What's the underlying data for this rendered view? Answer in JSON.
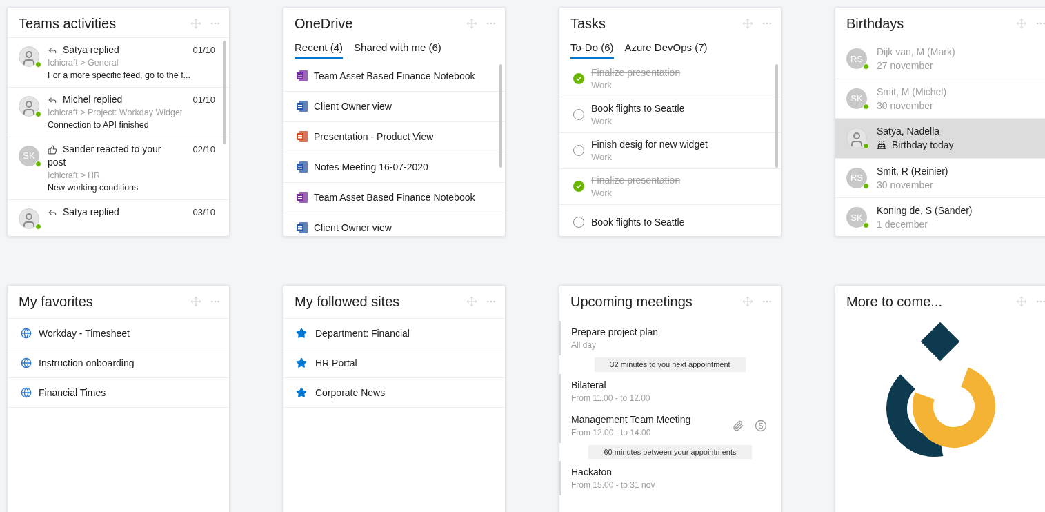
{
  "teams_activities": {
    "title": "Teams activities",
    "items": [
      {
        "avatar": {
          "kind": "photo",
          "online": true
        },
        "action": {
          "kind": "reply",
          "text": "Satya replied"
        },
        "date": "01/10",
        "channel": "Ichicraft > General",
        "message": "For a more specific feed, go to the f..."
      },
      {
        "avatar": {
          "kind": "photo",
          "online": true
        },
        "action": {
          "kind": "reply",
          "text": "Michel replied"
        },
        "date": "01/10",
        "channel": "Ichicraft > Project: Workday Widget",
        "message": "Connection to API finished"
      },
      {
        "avatar": {
          "kind": "initials",
          "initials": "SK",
          "online": true
        },
        "action": {
          "kind": "reaction",
          "text": "Sander reacted to your post"
        },
        "date": "02/10",
        "channel": "Ichicraft > HR",
        "message": "New working conditions"
      },
      {
        "avatar": {
          "kind": "photo",
          "online": true
        },
        "action": {
          "kind": "reply",
          "text": "Satya replied"
        },
        "date": "03/10"
      }
    ]
  },
  "onedrive": {
    "title": "OneDrive",
    "tabs": [
      {
        "label": "Recent (4)",
        "selected": true
      },
      {
        "label": "Shared with me (6)",
        "selected": false
      }
    ],
    "files": [
      {
        "kind": "onenote",
        "name": "Team Asset Based Finance Notebook"
      },
      {
        "kind": "word",
        "name": "Client Owner view"
      },
      {
        "kind": "powerpoint",
        "name": "Presentation - Product View"
      },
      {
        "kind": "word",
        "name": "Notes Meeting 16-07-2020"
      },
      {
        "kind": "onenote",
        "name": "Team Asset Based Finance Notebook"
      },
      {
        "kind": "word",
        "name": "Client Owner view"
      }
    ]
  },
  "tasks": {
    "title": "Tasks",
    "tabs": [
      {
        "label": "To-Do (6)",
        "selected": true
      },
      {
        "label": "Azure DevOps (7)",
        "selected": false
      }
    ],
    "items": [
      {
        "title": "Finalize presentation",
        "list": "Work",
        "done": true
      },
      {
        "title": "Book flights to Seattle",
        "list": "Work",
        "done": false
      },
      {
        "title": "Finish desig for new widget",
        "list": "Work",
        "done": false
      },
      {
        "title": "Finalize presentation",
        "list": "Work",
        "done": true
      },
      {
        "title": "Book flights to Seattle",
        "done": false
      }
    ]
  },
  "birthdays": {
    "title": "Birthdays",
    "items": [
      {
        "avatar": {
          "kind": "initials",
          "initials": "RS",
          "online": true
        },
        "name": "Dijk van, M (Mark)",
        "date": "27 november",
        "past": true,
        "today": false,
        "selected": false
      },
      {
        "avatar": {
          "kind": "initials",
          "initials": "SK",
          "online": true
        },
        "name": "Smit, M (Michel)",
        "date": "30 november",
        "past": true,
        "today": false,
        "selected": false
      },
      {
        "avatar": {
          "kind": "photo",
          "online": true
        },
        "name": "Satya, Nadella",
        "date": "Birthday today",
        "past": false,
        "today": true,
        "selected": true
      },
      {
        "avatar": {
          "kind": "initials",
          "initials": "RS",
          "online": true
        },
        "name": "Smit, R (Reinier)",
        "date": "30 november",
        "past": false,
        "today": false,
        "selected": false
      },
      {
        "avatar": {
          "kind": "initials",
          "initials": "SK",
          "online": true
        },
        "name": "Koning de, S (Sander)",
        "date": "1 december",
        "past": false,
        "today": false,
        "selected": false
      }
    ]
  },
  "my_favorites": {
    "title": "My favorites",
    "links": [
      "Workday - Timesheet",
      "Instruction onboarding",
      "Financial Times"
    ]
  },
  "my_followed_sites": {
    "title": "My followed sites",
    "sites": [
      "Department: Financial",
      "HR Portal",
      "Corporate News"
    ]
  },
  "upcoming_meetings": {
    "title": "Upcoming meetings",
    "items": [
      {
        "kind": "meeting",
        "title": "Prepare project plan",
        "time": "All day",
        "attachment": false,
        "skype": false
      },
      {
        "kind": "gap",
        "text": "32 minutes to you next appointment"
      },
      {
        "kind": "meeting",
        "title": "Bilateral",
        "time": "From 11.00 - to 12.00",
        "attachment": false,
        "skype": false
      },
      {
        "kind": "meeting",
        "title": "Management Team Meeting",
        "time": "From 12.00 - to 14.00",
        "attachment": true,
        "skype": true
      },
      {
        "kind": "gap",
        "text": "60 minutes between your appointments"
      },
      {
        "kind": "meeting",
        "title": "Hackaton",
        "time": "From 15.00 - to 31 nov",
        "attachment": false,
        "skype": false
      }
    ]
  },
  "more_to_come": {
    "title": "More to come..."
  }
}
